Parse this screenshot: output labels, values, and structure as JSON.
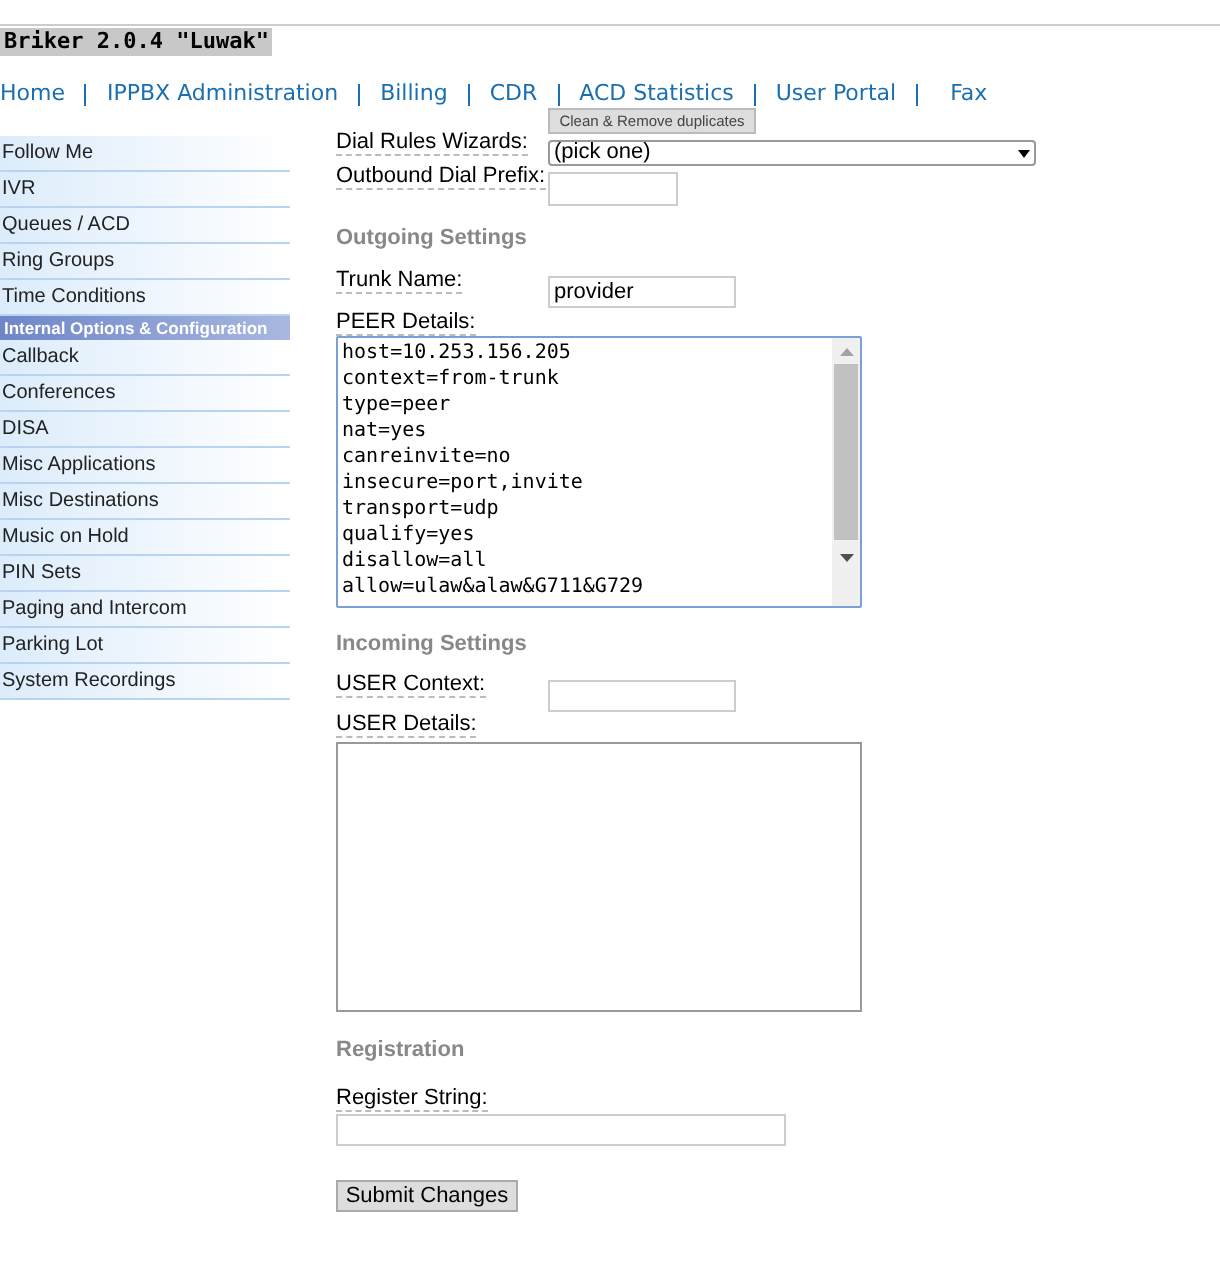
{
  "title": "Briker 2.0.4 \"Luwak\"",
  "nav": [
    "Home",
    "IPPBX Administration",
    "Billing",
    "CDR",
    "ACD Statistics",
    "User Portal",
    "Fax"
  ],
  "sidebar": [
    {
      "kind": "item",
      "label": "Follow Me"
    },
    {
      "kind": "item",
      "label": "IVR"
    },
    {
      "kind": "item",
      "label": "Queues / ACD"
    },
    {
      "kind": "item",
      "label": "Ring Groups"
    },
    {
      "kind": "item",
      "label": "Time Conditions"
    },
    {
      "kind": "header",
      "label": "Internal Options & Configuration"
    },
    {
      "kind": "item",
      "label": "Callback"
    },
    {
      "kind": "item",
      "label": "Conferences"
    },
    {
      "kind": "item",
      "label": "DISA"
    },
    {
      "kind": "item",
      "label": "Misc Applications"
    },
    {
      "kind": "item",
      "label": "Misc Destinations"
    },
    {
      "kind": "item",
      "label": "Music on Hold"
    },
    {
      "kind": "item",
      "label": "PIN Sets"
    },
    {
      "kind": "item",
      "label": "Paging and Intercom"
    },
    {
      "kind": "item",
      "label": "Parking Lot"
    },
    {
      "kind": "item",
      "label": "System Recordings"
    }
  ],
  "clean_button": "Clean & Remove duplicates",
  "dial_rules": {
    "label": "Dial Rules Wizards:",
    "value": "(pick one)"
  },
  "outbound_prefix": {
    "label": "Outbound Dial Prefix:"
  },
  "outgoing": {
    "heading": "Outgoing Settings",
    "trunk_label": "Trunk Name:",
    "trunk_value": "provider",
    "peer_label": "PEER Details:",
    "peer_lines": [
      "host=10.253.156.205",
      "context=from-trunk",
      "type=peer",
      "nat=yes",
      "canreinvite=no",
      "insecure=port,invite",
      "transport=udp",
      "qualify=yes",
      "disallow=all",
      "allow=ulaw&alaw&G711&G729"
    ]
  },
  "incoming": {
    "heading": "Incoming Settings",
    "context_label": "USER Context:",
    "details_label": "USER Details:"
  },
  "registration": {
    "heading": "Registration",
    "label": "Register String:"
  },
  "submit": "Submit Changes"
}
